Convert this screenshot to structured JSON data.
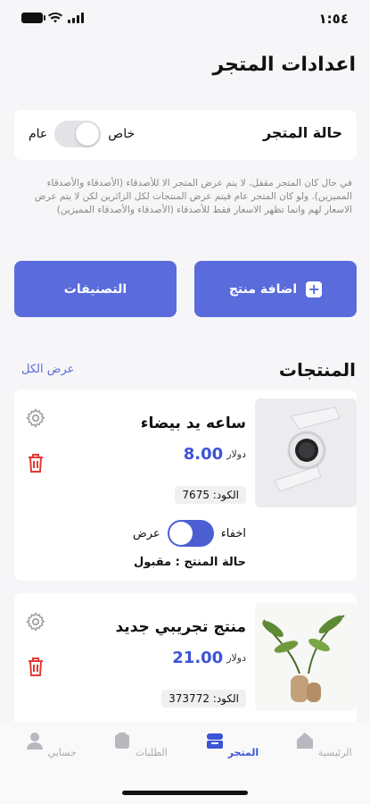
{
  "status_bar": {
    "time": "١:٥٤"
  },
  "header": {
    "title": "اعدادات المتجر"
  },
  "store_status": {
    "label": "حالة المتجر",
    "option_private": "خاص",
    "option_public": "عام"
  },
  "info_text": "في حال كان المتجر مقفل، لا يتم عرض المتجر الا للأصدقاء (الأصدقاء والأصدقاء المميزين). ولو كان المتجر عام فيتم عرض المنتجات لكل الزائرين لكن لا يتم عرض الاسعار لهم وانما تظهر الاسعار فقط للأصدقاء (الأصدقاء والأصدقاء المميزين)",
  "actions": {
    "add_product": "اضافة منتج",
    "categories": "التصنيفات"
  },
  "products_section": {
    "title": "المنتجات",
    "view_all": "عرض الكل"
  },
  "products": [
    {
      "name": "ساعه يد بيضاء",
      "price": "8.00",
      "currency": "دولار",
      "code_label": "الكود:",
      "code": "7675",
      "hide_label": "اخفاء",
      "show_label": "عرض",
      "status": "حالة المنتج : مقبول"
    },
    {
      "name": "منتج تجريبي جديد",
      "price": "21.00",
      "currency": "دولار",
      "code_label": "الكود:",
      "code": "373772"
    }
  ],
  "tabs": [
    {
      "label": "الرئيسية",
      "icon": "home-icon"
    },
    {
      "label": "المتجر",
      "icon": "store-icon",
      "active": true
    },
    {
      "label": "الطلبات",
      "icon": "orders-icon"
    },
    {
      "label": "حسابي",
      "icon": "account-icon"
    }
  ],
  "colors": {
    "accent": "#5a6bdb",
    "price": "#3c54d6",
    "danger": "#e53935"
  }
}
